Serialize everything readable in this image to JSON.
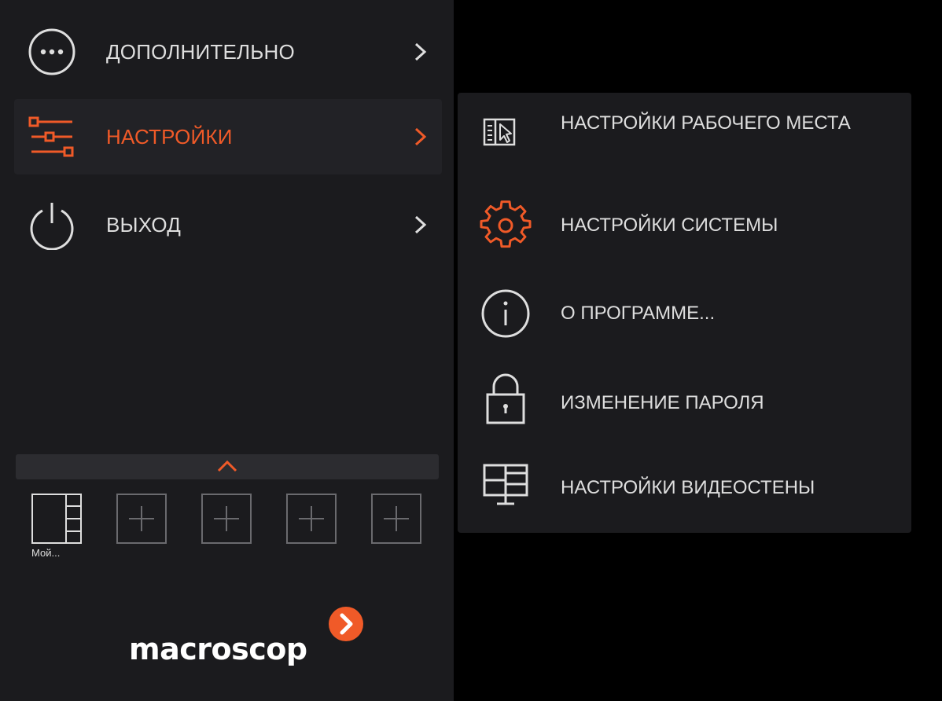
{
  "menu": {
    "items": [
      {
        "label": "ДОПОЛНИТЕЛЬНО",
        "icon": "more-icon"
      },
      {
        "label": "НАСТРОЙКИ",
        "icon": "sliders-icon",
        "active": true
      },
      {
        "label": "ВЫХОД",
        "icon": "power-icon"
      }
    ]
  },
  "layouts": {
    "first_caption": "Мой..."
  },
  "logo": {
    "text": "macroscop"
  },
  "submenu": {
    "items": [
      {
        "label": "НАСТРОЙКИ РАБОЧЕГО МЕСТА",
        "icon": "workplace-icon"
      },
      {
        "label": "НАСТРОЙКИ СИСТЕМЫ",
        "icon": "gear-icon",
        "highlight": true
      },
      {
        "label": "О ПРОГРАММЕ...",
        "icon": "info-icon"
      },
      {
        "label": "ИЗМЕНЕНИЕ ПАРОЛЯ",
        "icon": "lock-icon"
      },
      {
        "label": "НАСТРОЙКИ ВИДЕОСТЕНЫ",
        "icon": "videowall-icon"
      }
    ]
  },
  "colors": {
    "accent": "#f05a28",
    "panel": "#1b1b1e",
    "text": "#dedede"
  }
}
